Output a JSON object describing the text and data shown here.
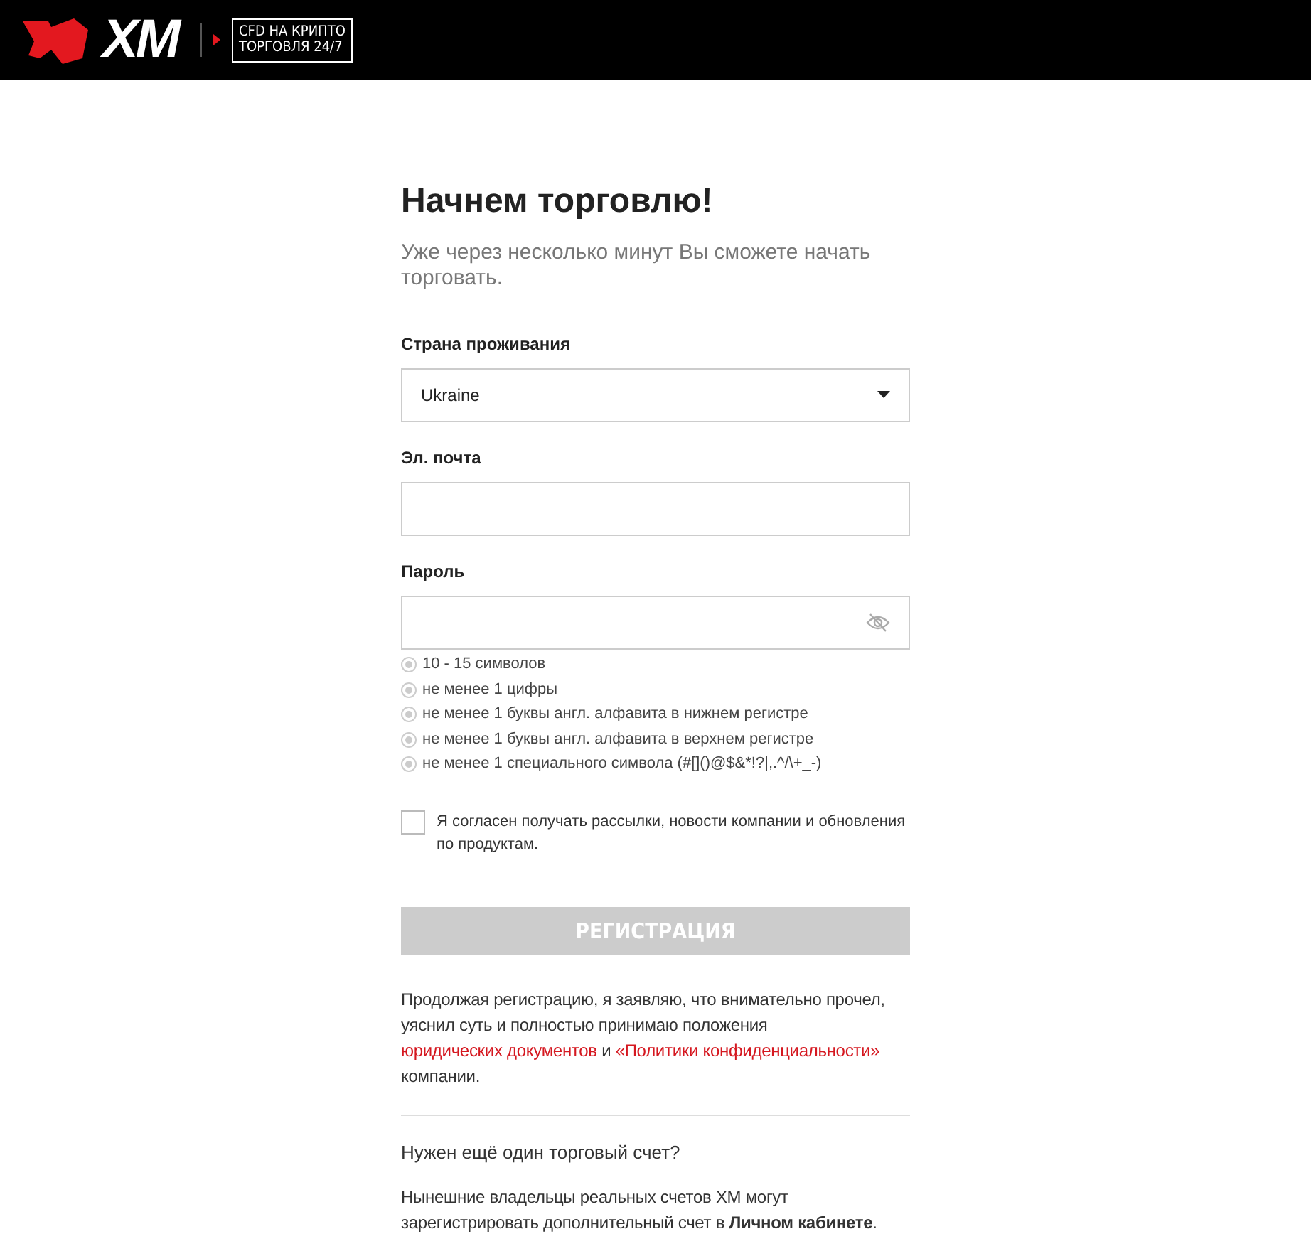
{
  "header": {
    "logo_text": "XM",
    "promo_lines": [
      "CFD НА КРИПТО",
      "ТОРГОВЛЯ 24/7"
    ]
  },
  "title": "Начнем торговлю!",
  "subtitle": "Уже через несколько минут Вы сможете начать торговать.",
  "country": {
    "label": "Страна проживания",
    "value": "Ukraine"
  },
  "email": {
    "label": "Эл. почта"
  },
  "password": {
    "label": "Пароль",
    "visible": false
  },
  "rules": [
    {
      "text": "10 - 15 символов",
      "met": false
    },
    {
      "text": "не менее 1 цифры",
      "met": false
    },
    {
      "text": "не менее 1 буквы англ. алфавита в нижнем регистре",
      "met": false
    },
    {
      "text": "не менее 1 буквы англ. алфавита в верхнем регистре",
      "met": false
    },
    {
      "text": "не менее 1 специального символа (#[]()@$&*!?|,.^/\\+_-)",
      "met": false
    }
  ],
  "consent": {
    "text": "Я согласен получать рассылки, новости компании и обновления по продуктам.",
    "checked": false
  },
  "submit": {
    "label": "РЕГИСТРАЦИЯ",
    "disabled": true
  },
  "legal": [
    {
      "kind": "text",
      "text": "Продолжая регистрацию, я заявляю, что внимательно прочел, уяснил суть и полностью принимаю положения "
    },
    {
      "kind": "link",
      "text": "юридических документов"
    },
    {
      "kind": "text",
      "text": " и "
    },
    {
      "kind": "link",
      "text": "«Политики конфиденциальности»"
    },
    {
      "kind": "text",
      "text": " компании."
    }
  ],
  "extra": {
    "heading": "Нужен ещё один торговый счет?",
    "text": "Нынешние владельцы реальных счетов XM могут зарегистрировать дополнительный счет в **Личном кабинете**."
  }
}
